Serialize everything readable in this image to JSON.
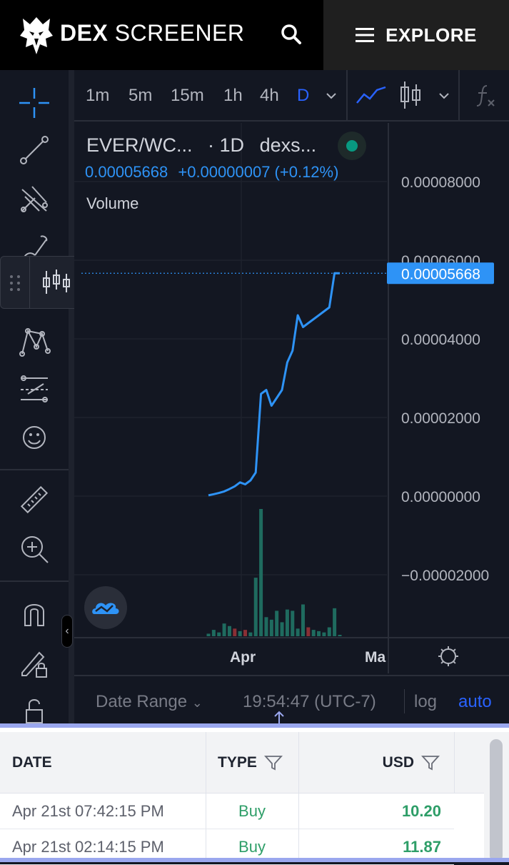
{
  "header": {
    "brand_bold": "DEX",
    "brand_light": "SCREENER",
    "explore_label": "EXPLORE"
  },
  "timeframes": [
    "1m",
    "5m",
    "15m",
    "1h",
    "4h",
    "D"
  ],
  "chart": {
    "symbol": "EVER/WC...",
    "interval": "· 1D",
    "source": "dexs...",
    "last_price": "0.00005668",
    "change": "+0.00000007 (+0.12%)",
    "volume_label": "Volume",
    "price_tag": "0.00005668",
    "accent": "#2e93f6"
  },
  "chart_data": {
    "type": "line",
    "x_ticks": [
      "Apr",
      "Ma"
    ],
    "y_ticks": [
      "0.00008000",
      "0.00006000",
      "0.00004000",
      "0.00002000",
      "0.00000000",
      "−0.00002000"
    ],
    "ylim": [
      -2e-05,
      8e-05
    ],
    "line": [
      2e-07,
      5e-07,
      8e-07,
      1.2e-06,
      1.8e-06,
      2.5e-06,
      3.5e-06,
      3e-06,
      4e-06,
      6e-06,
      2.6e-05,
      2.7e-05,
      2.3e-05,
      2.5e-05,
      2.7e-05,
      3.4e-05,
      3.7e-05,
      4.6e-05,
      4.3e-05,
      4.4e-05,
      4.5e-05,
      4.6e-05,
      4.7e-05,
      4.8e-05,
      5.67e-05,
      5.668e-05
    ],
    "volume": [
      0.02,
      0.05,
      0.03,
      0.1,
      0.08,
      0.06,
      0.04,
      0.05,
      0.03,
      0.46,
      1.0,
      0.15,
      0.13,
      0.2,
      0.11,
      0.21,
      0.2,
      0.06,
      0.25,
      0.07,
      0.05,
      0.04,
      0.03,
      0.07,
      0.22,
      0.01
    ],
    "volume_down": [
      5,
      7,
      19
    ],
    "grid": true
  },
  "bottombar": {
    "date_range": "Date Range",
    "time": "19:54:47 (UTC-7)",
    "log": "log",
    "auto": "auto"
  },
  "table": {
    "headers": {
      "date": "DATE",
      "type": "TYPE",
      "usd": "USD"
    },
    "rows": [
      {
        "date": "Apr 21st 07:42:15 PM",
        "type": "Buy",
        "usd": "10.20"
      },
      {
        "date": "Apr 21st 02:14:15 PM",
        "type": "Buy",
        "usd": "11.87"
      }
    ],
    "buy_color": "#2e9e68"
  }
}
